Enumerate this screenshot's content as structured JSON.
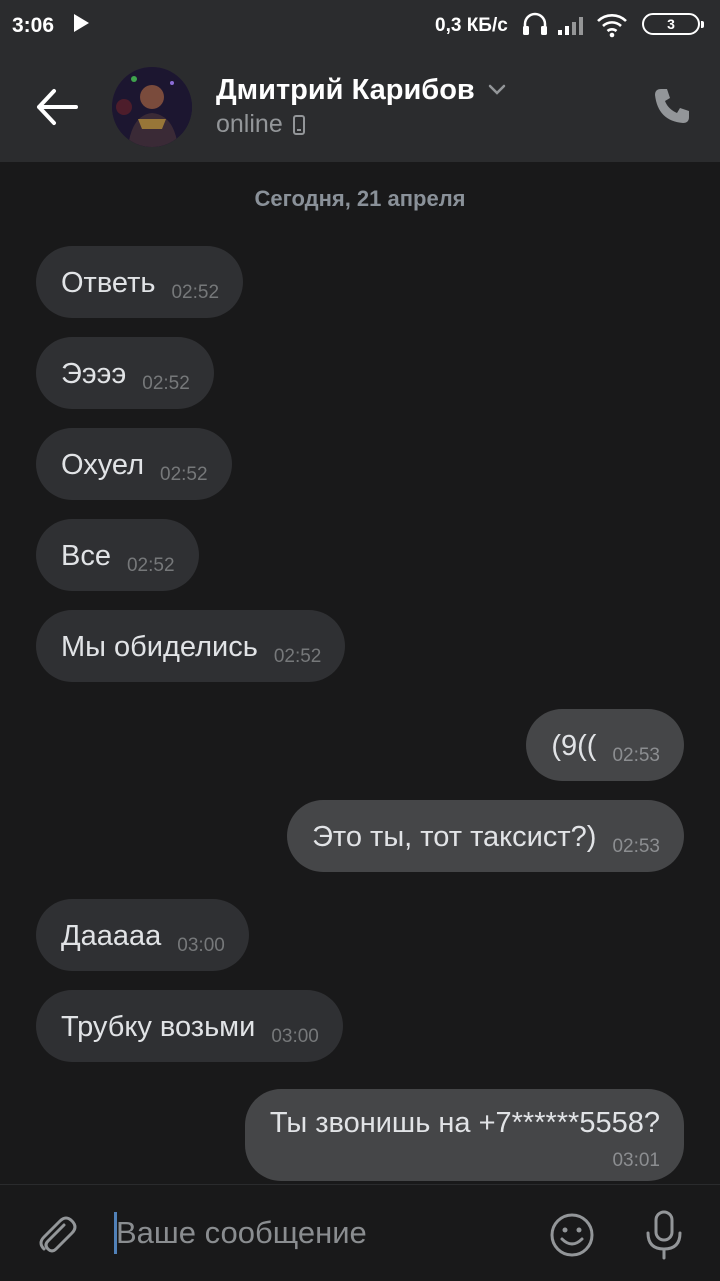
{
  "status_bar": {
    "time": "3:06",
    "speed": "0,3 КБ/с",
    "battery": "3"
  },
  "header": {
    "contact_name": "Дмитрий Карибов",
    "status": "online"
  },
  "chat": {
    "date_divider": "Сегодня, 21 апреля",
    "messages": [
      {
        "direction": "in",
        "text": "Ответь",
        "time": "02:52"
      },
      {
        "direction": "in",
        "text": "Ээээ",
        "time": "02:52"
      },
      {
        "direction": "in",
        "text": "Охуел",
        "time": "02:52"
      },
      {
        "direction": "in",
        "text": "Все",
        "time": "02:52"
      },
      {
        "direction": "in",
        "text": "Мы обиделись",
        "time": "02:52"
      },
      {
        "direction": "out",
        "text": "(9((",
        "time": "02:53"
      },
      {
        "direction": "out",
        "text": "Это ты, тот таксист?)",
        "time": "02:53"
      },
      {
        "direction": "in",
        "text": "Дааааа",
        "time": "03:00"
      },
      {
        "direction": "in",
        "text": "Трубку возьми",
        "time": "03:00"
      },
      {
        "direction": "out",
        "text": "Ты звонишь на +7******5558?",
        "time": "03:01"
      }
    ]
  },
  "composer": {
    "placeholder": "Ваше сообщение"
  },
  "icons": {
    "back": "back-arrow-icon",
    "call": "phone-icon",
    "attach": "paperclip-icon",
    "emoji": "smile-icon",
    "voice": "microphone-icon"
  },
  "colors": {
    "background": "#19191a",
    "bar": "#2b2c2e",
    "incoming": "#2f3033",
    "outgoing": "#454648",
    "accent": "#5181b8"
  }
}
